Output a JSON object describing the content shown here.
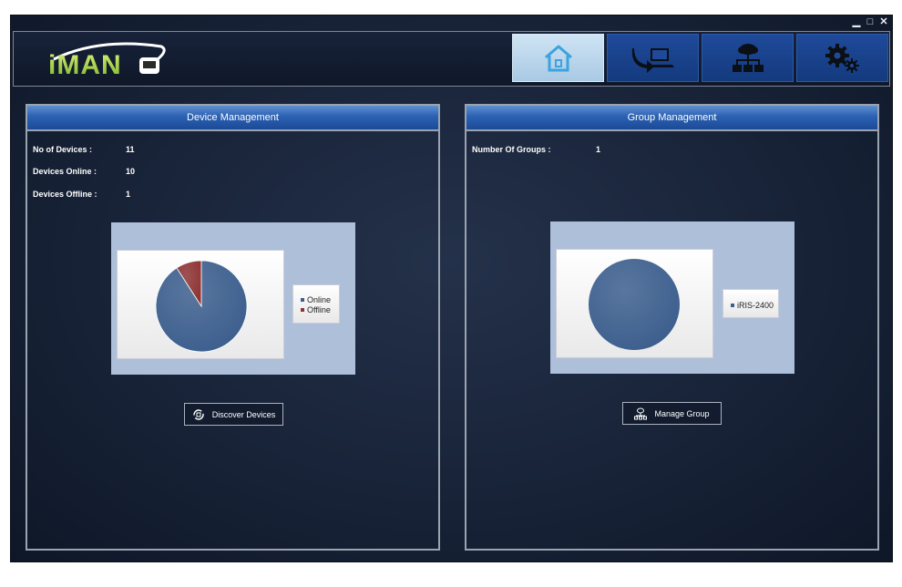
{
  "app": {
    "logo_text": "iMAN"
  },
  "window_controls": {
    "minimize": "▁",
    "maximize": "□",
    "close": "✕"
  },
  "nav": [
    {
      "id": "home",
      "icon": "home-icon",
      "active": true
    },
    {
      "id": "devices",
      "icon": "device-transfer-icon",
      "active": false
    },
    {
      "id": "network",
      "icon": "network-tree-icon",
      "active": false
    },
    {
      "id": "settings",
      "icon": "gears-icon",
      "active": false
    }
  ],
  "device_management": {
    "title": "Device Management",
    "stats": [
      {
        "label": "No of Devices :",
        "value": "11"
      },
      {
        "label": "Devices Online :",
        "value": "10"
      },
      {
        "label": "Devices Offline :",
        "value": "1"
      }
    ],
    "button_label": "Discover Devices"
  },
  "group_management": {
    "title": "Group Management",
    "stats": [
      {
        "label": "Number Of Groups :",
        "value": "1"
      }
    ],
    "button_label": "Manage Group"
  },
  "chart_data": [
    {
      "type": "pie",
      "categories": [
        "Online",
        "Offline"
      ],
      "values": [
        10,
        1
      ],
      "colors": [
        "#3d5f8e",
        "#8e3434"
      ],
      "legend": "right"
    },
    {
      "type": "pie",
      "categories": [
        "iRIS-2400"
      ],
      "values": [
        1
      ],
      "colors": [
        "#3d5f8e"
      ],
      "legend": "right"
    }
  ]
}
